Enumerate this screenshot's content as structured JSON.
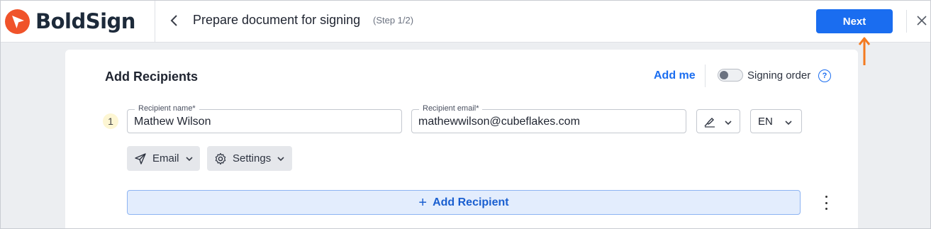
{
  "header": {
    "brand": "BoldSign",
    "title": "Prepare document for signing",
    "step": "(Step 1/2)",
    "next_label": "Next",
    "icons": {
      "back": "chevron-left-icon",
      "close": "close-icon",
      "logo": "boldsign-logo-icon"
    }
  },
  "recipients": {
    "title": "Add Recipients",
    "add_me_label": "Add me",
    "signing_order_label": "Signing order",
    "signing_order_enabled": false,
    "help_label": "?",
    "rows": [
      {
        "number": "1",
        "name_label": "Recipient name*",
        "name_value": "Mathew Wilson",
        "email_label": "Recipient email*",
        "email_value": "mathewwilson@cubeflakes.com",
        "role_icon": "signer-pen-icon",
        "language": "EN",
        "delivery_label": "Email",
        "settings_label": "Settings"
      }
    ],
    "add_recipient_label": "Add Recipient"
  },
  "colors": {
    "brand": "#f0532a",
    "primary": "#1a6df0",
    "annotation_arrow": "#f47a20"
  }
}
